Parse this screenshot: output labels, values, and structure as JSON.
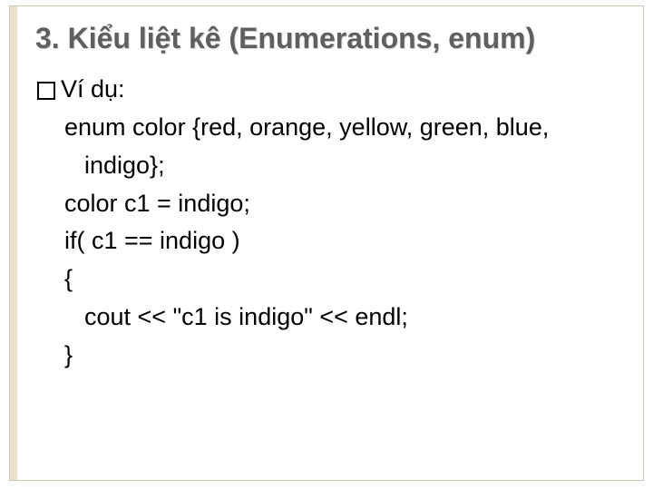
{
  "slide": {
    "title": "3. Kiểu liệt kê (Enumerations, enum)",
    "bullet_label": "Ví dụ:",
    "code": {
      "l1a": "enum color {red, orange, yellow, green, blue,",
      "l1b": "indigo};",
      "l2": "color c1 = indigo;",
      "l3": "if( c1 == indigo )",
      "l4": "{",
      "l5": "cout << \"c1 is indigo\" << endl;",
      "l6": "}"
    }
  }
}
